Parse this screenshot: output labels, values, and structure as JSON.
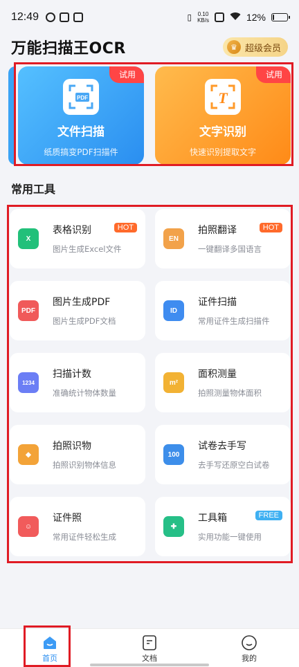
{
  "status_bar": {
    "time": "12:49",
    "net_speed_value": "0.10",
    "net_speed_unit": "KB/s",
    "battery_percent_text": "12%",
    "battery_level": 0.12
  },
  "header": {
    "title": "万能扫描王OCR",
    "vip_label": "超级会员"
  },
  "banners": [
    {
      "title": "文件扫描",
      "subtitle": "纸质搞变PDF扫描件",
      "badge": "试用",
      "icon_text": "PDF",
      "color": "#2a8ef0"
    },
    {
      "title": "文字识别",
      "subtitle": "快速识别提取文字",
      "badge": "试用",
      "icon_text": "T",
      "color": "#ff8a17"
    }
  ],
  "section_title": "常用工具",
  "tools": [
    {
      "name": "表格识别",
      "desc": "图片生成Excel文件",
      "tag": "HOT",
      "icon": "table-icon",
      "icon_text": "X",
      "color": "#22c07a"
    },
    {
      "name": "拍照翻译",
      "desc": "一键翻译多国语言",
      "tag": "HOT",
      "icon": "translate-icon",
      "icon_text": "EN",
      "color": "#f2a24a"
    },
    {
      "name": "图片生成PDF",
      "desc": "图片生成PDF文档",
      "tag": "",
      "icon": "pdf-icon",
      "icon_text": "PDF",
      "color": "#f05a5a"
    },
    {
      "name": "证件扫描",
      "desc": "常用证件生成扫描件",
      "tag": "",
      "icon": "id-card-icon",
      "icon_text": "ID",
      "color": "#3f8cf0"
    },
    {
      "name": "扫描计数",
      "desc": "准确统计物体数量",
      "tag": "",
      "icon": "count-icon",
      "icon_text": "1234",
      "color": "#6b7ef5"
    },
    {
      "name": "面积测量",
      "desc": "拍照测量物体面积",
      "tag": "",
      "icon": "area-icon",
      "icon_text": "m²",
      "color": "#f2b234"
    },
    {
      "name": "拍照识物",
      "desc": "拍照识别物体信息",
      "tag": "",
      "icon": "object-icon",
      "icon_text": "◆",
      "color": "#f3a338"
    },
    {
      "name": "试卷去手写",
      "desc": "去手写还原空白试卷",
      "tag": "",
      "icon": "paper-icon",
      "icon_text": "100",
      "color": "#3d8eea"
    },
    {
      "name": "证件照",
      "desc": "常用证件轻松生成",
      "tag": "",
      "icon": "portrait-icon",
      "icon_text": "☺",
      "color": "#f15b5b"
    },
    {
      "name": "工具箱",
      "desc": "实用功能一键使用",
      "tag": "FREE",
      "icon": "toolbox-icon",
      "icon_text": "✚",
      "color": "#26bf87"
    }
  ],
  "bottom_nav": [
    {
      "label": "首页",
      "icon": "home-icon",
      "active": true
    },
    {
      "label": "文档",
      "icon": "document-icon",
      "active": false
    },
    {
      "label": "我的",
      "icon": "profile-icon",
      "active": false
    }
  ]
}
